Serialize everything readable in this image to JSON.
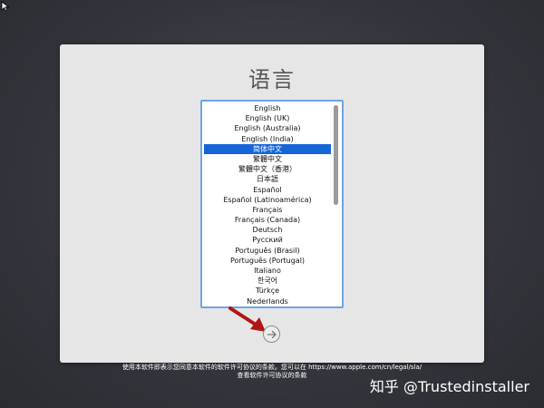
{
  "title": "语言",
  "languages": [
    "English",
    "English (UK)",
    "English (Australia)",
    "English (India)",
    "简体中文",
    "繁體中文",
    "繁體中文（香港）",
    "日本語",
    "Español",
    "Español (Latinoamérica)",
    "Français",
    "Français (Canada)",
    "Deutsch",
    "Русский",
    "Português (Brasil)",
    "Português (Portugal)",
    "Italiano",
    "한국어",
    "Türkçe",
    "Nederlands"
  ],
  "selected_language": "简体中文",
  "footer": {
    "line1": "使用本软件即表示您同意本软件的软件许可协议的条款。您可以在 https://www.apple.com/cn/legal/sla/",
    "line2": "查看软件许可协议的条款"
  },
  "watermark": "知乎 @Trustedinstaller",
  "colors": {
    "selection": "#1565d8",
    "list_focus_border": "#6fa3e6",
    "annotation_arrow": "#b01515"
  }
}
